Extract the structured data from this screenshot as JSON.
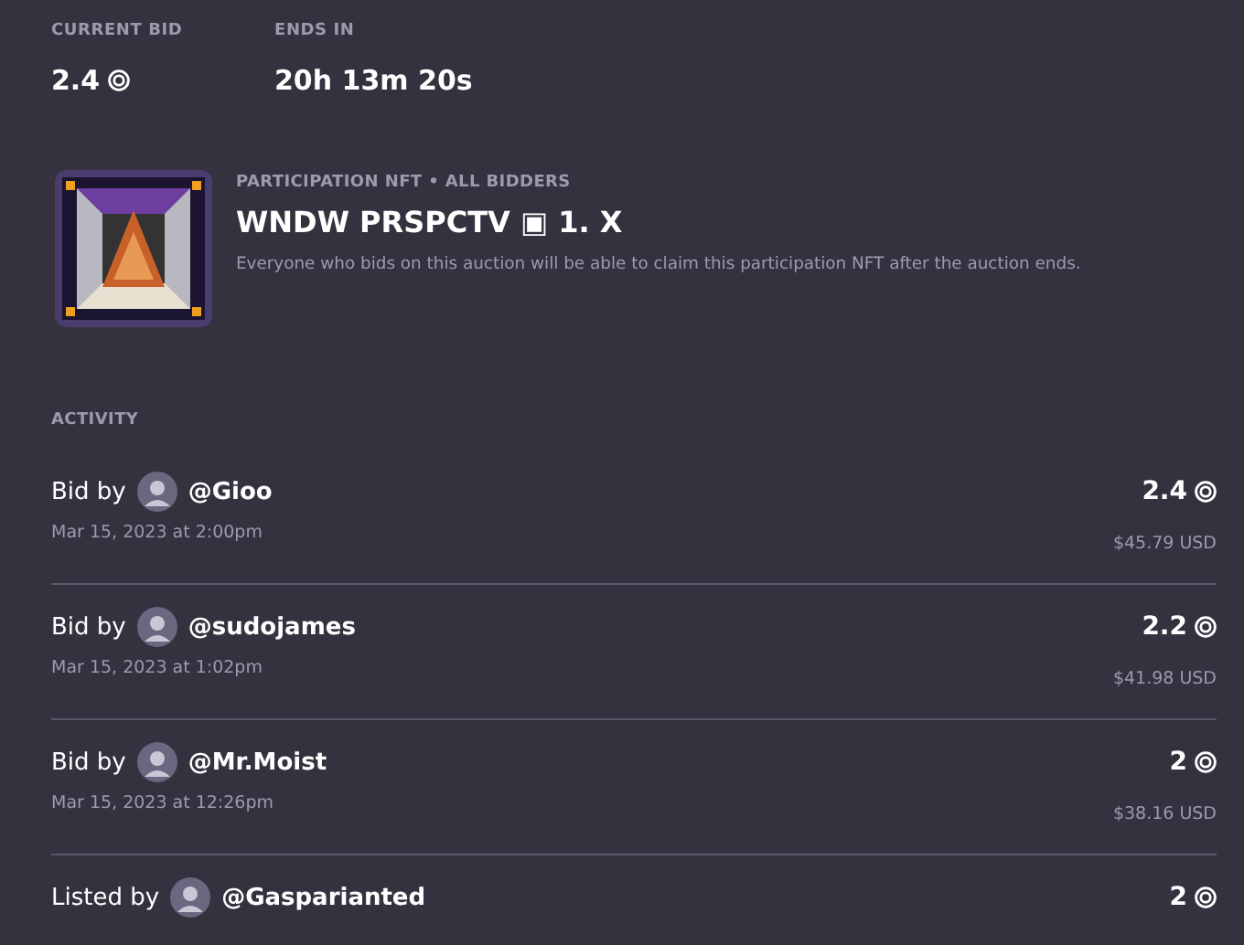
{
  "summary": [
    {
      "label": "CURRENT BID",
      "value": "2.4",
      "coin": true
    },
    {
      "label": "ENDS IN",
      "value": "20h 13m 20s",
      "coin": false
    }
  ],
  "participation": {
    "eyebrow": "PARTICIPATION NFT • ALL BIDDERS",
    "title": "WNDW PRSPCTV ▣ 1. X",
    "description": "Everyone who bids on this auction will be able to claim this participation NFT after the auction ends."
  },
  "activity": {
    "heading": "ACTIVITY",
    "items": [
      {
        "action": "Bid by",
        "user": "@Gioo",
        "date": "Mar 15, 2023 at 2:00pm",
        "amount": "2.4",
        "usd": "$45.79 USD"
      },
      {
        "action": "Bid by",
        "user": "@sudojames",
        "date": "Mar 15, 2023 at 1:02pm",
        "amount": "2.2",
        "usd": "$41.98 USD"
      },
      {
        "action": "Bid by",
        "user": "@Mr.Moist",
        "date": "Mar 15, 2023 at 12:26pm",
        "amount": "2",
        "usd": "$38.16 USD"
      },
      {
        "action": "Listed by",
        "user": "@Gasparianted",
        "amount": "2"
      }
    ]
  }
}
